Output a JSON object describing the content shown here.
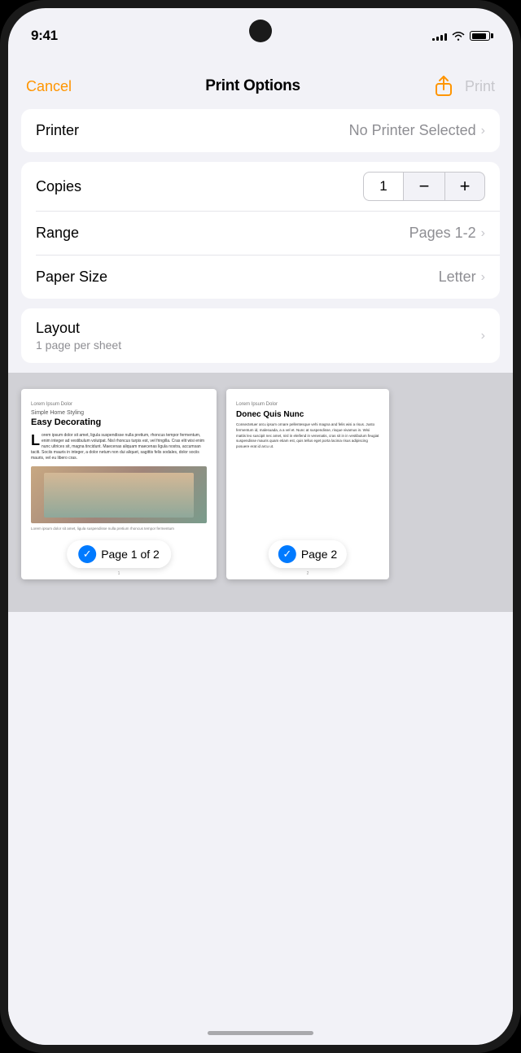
{
  "status_bar": {
    "time": "9:41",
    "signal_bars": [
      3,
      5,
      7,
      9,
      11
    ],
    "battery_level": 85
  },
  "header": {
    "cancel_label": "Cancel",
    "title": "Print Options",
    "print_label": "Print"
  },
  "printer_section": {
    "label": "Printer",
    "value": "No Printer Selected",
    "chevron": "›"
  },
  "copies_section": {
    "label": "Copies",
    "value": "1",
    "minus_label": "−",
    "plus_label": "+"
  },
  "range_section": {
    "label": "Range",
    "value": "Pages 1-2",
    "chevron": "›"
  },
  "paper_size_section": {
    "label": "Paper Size",
    "value": "Letter",
    "chevron": "›"
  },
  "layout_section": {
    "label": "Layout",
    "sublabel": "1 page per sheet",
    "chevron": "›"
  },
  "preview": {
    "page1": {
      "header": "Lorem Ipsum Dolor",
      "subtitle": "Simple Home Styling",
      "title": "Easy Decorating",
      "body": "Lorem ipsum dolor sit amet, ligula suspendisse nulla pretium, rhoncus tempor fermentum, enim integer ad vestibulum volutpat. Nisl rhoncus turpis est, vel fringilla. Cras elit wisi enim nunc ultrices sit, magna tincidunt. Maecenas aliquam maecenas ligula nostra, accumsan taciti. Sociis mauris in integer, a dolor netum non dui aliquet, sagittis felis sodales, dolor sociis mauris, vel eu libero cras.",
      "caption": "Lorem ipsum dolor sit amet, ligula suspendisse nulla pretium rhoncus tempor fermentum",
      "badge": "Page 1 of 2",
      "page_number": "1"
    },
    "page2": {
      "header": "Lorem Ipsum Dolor",
      "title": "Donec Quis Nunc",
      "body": "Consectetuer arcu ipsum ornare pellentesque vehi magna and felis wisi a risus. Justo fermentum id, malesuada, a a vel et. Nunc at suspendisse, risque vivamus in. Wisi mattis leo suscipit nec amet, nisl in eleifend in venenatis, cras sit in in vestibulum feugiat suspendisse mauris quam etiam est, quis tellus eget porta lacinia risus adipiscing posuere erat id arcu ut.",
      "badge": "Page 2",
      "page_number": "2"
    }
  },
  "home_indicator": true
}
